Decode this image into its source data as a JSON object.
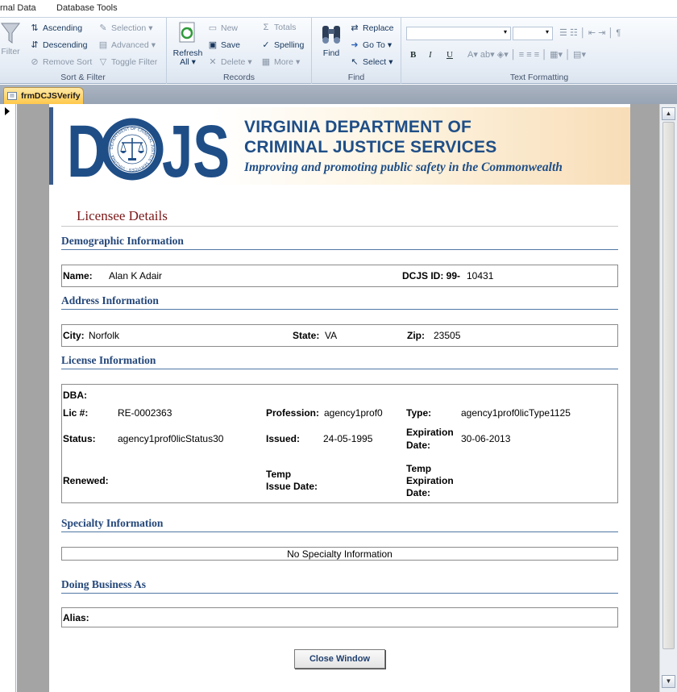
{
  "ribbon": {
    "tabs": [
      "rnal Data",
      "Database Tools"
    ],
    "sort_filter": {
      "filter": "Filter",
      "ascending": "Ascending",
      "descending": "Descending",
      "remove_sort": "Remove Sort",
      "selection": "Selection",
      "advanced": "Advanced",
      "toggle_filter": "Toggle Filter",
      "title": "Sort & Filter"
    },
    "records": {
      "refresh": "Refresh",
      "refresh_sub": "All",
      "new": "New",
      "save": "Save",
      "delete": "Delete",
      "totals": "Totals",
      "spelling": "Spelling",
      "more": "More",
      "title": "Records"
    },
    "find": {
      "find": "Find",
      "replace": "Replace",
      "goto": "Go To",
      "select": "Select",
      "title": "Find"
    },
    "text_formatting": {
      "bold": "B",
      "italic": "I",
      "underline": "U",
      "title": "Text Formatting"
    }
  },
  "document_tab": {
    "label": "frmDCJSVerify"
  },
  "banner": {
    "logo_text": "DCJS",
    "title_line1": "VIRGINIA DEPARTMENT OF",
    "title_line2": "CRIMINAL JUSTICE SERVICES",
    "tagline": "Improving and promoting public safety in the Commonwealth",
    "seal_text": "DEPARTMENT OF CRIMINAL JUSTICE SERVICES · VIRGINIA ·"
  },
  "form": {
    "heading": "Licensee Details",
    "demographic": {
      "title": "Demographic Information",
      "name_label": "Name:",
      "name_value": "Alan K Adair",
      "dcjs_id_label": "DCJS ID: 99-",
      "dcjs_id_value": "10431"
    },
    "address": {
      "title": "Address Information",
      "city_label": "City:",
      "city_value": "Norfolk",
      "state_label": "State:",
      "state_value": "VA",
      "zip_label": "Zip:",
      "zip_value": "23505"
    },
    "license": {
      "title": "License Information",
      "dba_label": "DBA:",
      "lic_label": "Lic #:",
      "lic_value": "RE-0002363",
      "profession_label": "Profession:",
      "profession_value": "agency1prof0",
      "type_label": "Type:",
      "type_value": "agency1prof0licType1125",
      "status_label": "Status:",
      "status_value": "agency1prof0licStatus30",
      "issued_label": "Issued:",
      "issued_value": "24-05-1995",
      "expiration_label_1": "Expiration",
      "expiration_label_2": "Date:",
      "expiration_value": "30-06-2013",
      "renewed_label": "Renewed:",
      "temp_issue_label_1": "Temp",
      "temp_issue_label_2": "Issue Date:",
      "temp_exp_label_1": "Temp",
      "temp_exp_label_2": "Expiration",
      "temp_exp_label_3": "Date:"
    },
    "specialty": {
      "title": "Specialty Information",
      "empty_text": "No Specialty Information"
    },
    "dba_section": {
      "title": "Doing Business As",
      "alias_label": "Alias:"
    },
    "close_button": "Close Window"
  },
  "colors": {
    "brand_blue": "#1f4e87",
    "heading_red": "#7b1818",
    "section_blue": "#24477a"
  }
}
